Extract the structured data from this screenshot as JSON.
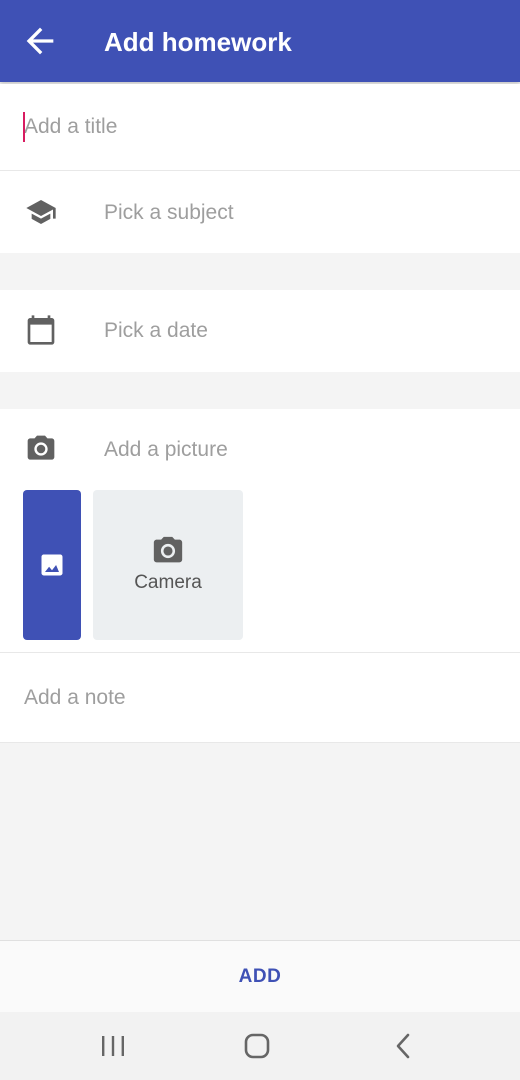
{
  "appbar": {
    "title": "Add homework",
    "back_icon": "arrow-back-icon",
    "background_color": "#3f51b5"
  },
  "form": {
    "title_placeholder": "Add a title",
    "subject": {
      "icon": "graduation-cap-icon",
      "label": "Pick a subject"
    },
    "date": {
      "icon": "calendar-icon",
      "label": "Pick a date"
    },
    "picture": {
      "icon": "camera-icon",
      "label": "Add a picture",
      "gallery_icon": "image-icon",
      "camera_tile_icon": "camera-icon",
      "camera_tile_label": "Camera"
    },
    "note_placeholder": "Add a note"
  },
  "bottom_bar": {
    "add_label": "ADD",
    "accent_color": "#3f51b5"
  },
  "system_nav": {
    "recents_icon": "recents-icon",
    "home_icon": "home-icon",
    "back_icon": "back-chevron-icon"
  }
}
